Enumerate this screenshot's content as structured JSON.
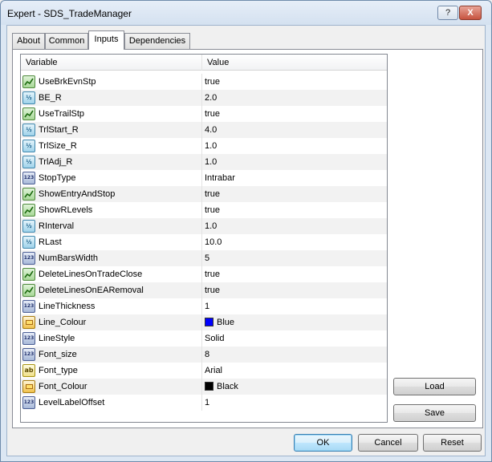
{
  "window": {
    "title": "Expert - SDS_TradeManager",
    "help_label": "?",
    "close_label": "X"
  },
  "tabs": [
    {
      "label": "About"
    },
    {
      "label": "Common"
    },
    {
      "label": "Inputs",
      "active": true
    },
    {
      "label": "Dependencies"
    }
  ],
  "grid": {
    "col_variable": "Variable",
    "col_value": "Value",
    "rows": [
      {
        "icon": "bool-icon",
        "type_glyph": "",
        "name": "UseBrkEvnStp",
        "value": "true"
      },
      {
        "icon": "double-icon",
        "type_glyph": "½",
        "name": "BE_R",
        "value": "2.0"
      },
      {
        "icon": "bool-icon",
        "type_glyph": "",
        "name": "UseTrailStp",
        "value": "true"
      },
      {
        "icon": "double-icon",
        "type_glyph": "½",
        "name": "TrlStart_R",
        "value": "4.0"
      },
      {
        "icon": "double-icon",
        "type_glyph": "½",
        "name": "TrlSize_R",
        "value": "1.0"
      },
      {
        "icon": "double-icon",
        "type_glyph": "½",
        "name": "TrlAdj_R",
        "value": "1.0"
      },
      {
        "icon": "int-icon",
        "type_glyph": "123",
        "name": "StopType",
        "value": "Intrabar"
      },
      {
        "icon": "bool-icon",
        "type_glyph": "",
        "name": "ShowEntryAndStop",
        "value": "true"
      },
      {
        "icon": "bool-icon",
        "type_glyph": "",
        "name": "ShowRLevels",
        "value": "true"
      },
      {
        "icon": "double-icon",
        "type_glyph": "½",
        "name": "RInterval",
        "value": "1.0"
      },
      {
        "icon": "double-icon",
        "type_glyph": "½",
        "name": "RLast",
        "value": "10.0"
      },
      {
        "icon": "int-icon",
        "type_glyph": "123",
        "name": "NumBarsWidth",
        "value": "5"
      },
      {
        "icon": "bool-icon",
        "type_glyph": "",
        "name": "DeleteLinesOnTradeClose",
        "value": "true"
      },
      {
        "icon": "bool-icon",
        "type_glyph": "",
        "name": "DeleteLinesOnEARemoval",
        "value": "true"
      },
      {
        "icon": "int-icon",
        "type_glyph": "123",
        "name": "LineThickness",
        "value": "1"
      },
      {
        "icon": "color-icon",
        "type_glyph": "",
        "name": "Line_Colour",
        "value": "Blue",
        "swatch": "#0000ff"
      },
      {
        "icon": "int-icon",
        "type_glyph": "123",
        "name": "LineStyle",
        "value": "Solid"
      },
      {
        "icon": "int-icon",
        "type_glyph": "123",
        "name": "Font_size",
        "value": "8"
      },
      {
        "icon": "string-icon",
        "type_glyph": "ab",
        "name": "Font_type",
        "value": "Arial"
      },
      {
        "icon": "color-icon",
        "type_glyph": "",
        "name": "Font_Colour",
        "value": "Black",
        "swatch": "#000000"
      },
      {
        "icon": "int-icon",
        "type_glyph": "123",
        "name": "LevelLabelOffset",
        "value": "1"
      }
    ]
  },
  "buttons": {
    "load": "Load",
    "save": "Save",
    "ok": "OK",
    "cancel": "Cancel",
    "reset": "Reset"
  }
}
